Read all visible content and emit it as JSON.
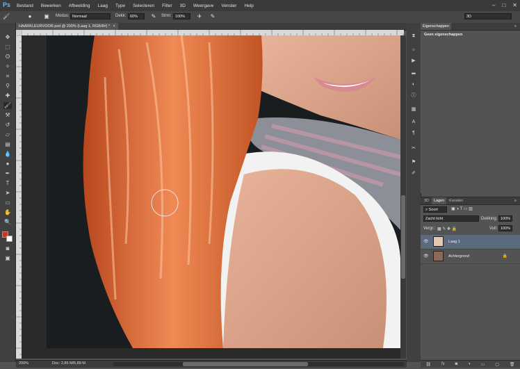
{
  "menubar": {
    "logo": "Ps",
    "items": [
      "Bestand",
      "Bewerken",
      "Afbeelding",
      "Laag",
      "Type",
      "Selecteren",
      "Filter",
      "3D",
      "Weergave",
      "Venster",
      "Help"
    ],
    "window_buttons": [
      "–",
      "□",
      "✕"
    ]
  },
  "options": {
    "mode_label": "Modus:",
    "mode_value": "Normaal",
    "opacity_label": "Dekk:",
    "opacity_value": "60%",
    "flow_label": "Strm:",
    "flow_value": "100%",
    "workspace_value": "3D"
  },
  "document": {
    "tab_title": "HAARKLEURVOOR.psd @ 200% (Laag 1, RGB/8#) *",
    "close": "×",
    "zoom": "200%",
    "doc_size": "Doc: 2,85 M/5,89 M"
  },
  "properties": {
    "tab": "Eigenschappen",
    "empty_text": "Geen eigenschappen"
  },
  "layers": {
    "tabs": [
      "3D",
      "Lagen",
      "Kanalen"
    ],
    "active_tab": "Lagen",
    "filter_label": "Soort",
    "blend_mode": "Zacht licht",
    "opacity_label": "Dekking:",
    "opacity_value": "100%",
    "lock_label": "Vergr.:",
    "fill_label": "Vull:",
    "fill_value": "100%",
    "items": [
      {
        "name": "Laag 1",
        "selected": true
      },
      {
        "name": "Achtergrond",
        "selected": false,
        "locked": true
      }
    ],
    "footer_icons": [
      "link-icon",
      "fx-icon",
      "mask-icon",
      "adjustment-icon",
      "group-icon",
      "new-layer-icon",
      "trash-icon"
    ]
  },
  "colors": {
    "foreground": "#c0391f",
    "background": "#ffffff"
  }
}
